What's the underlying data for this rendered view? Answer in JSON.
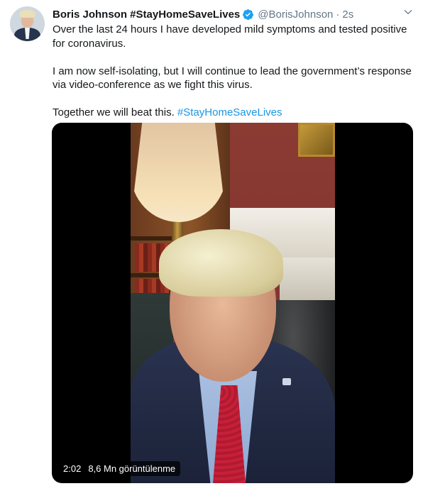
{
  "author": {
    "display_name": "Boris Johnson #StayHomeSaveLives",
    "handle": "@BorisJohnson",
    "separator": "·",
    "timestamp": "2s",
    "verified": true,
    "verified_icon": "verified-badge-icon"
  },
  "tweet": {
    "paragraph_1": "Over the last 24 hours I have developed mild symptoms and tested positive for coronavirus.",
    "paragraph_2": "I am now self-isolating, but I will continue to lead the government’s response via video-conference as we fight this virus.",
    "paragraph_3_text": "Together we will beat this. ",
    "paragraph_3_hashtag": "#StayHomeSaveLives"
  },
  "video": {
    "duration": "2:02",
    "views": "8,6 Mn görüntülenme"
  },
  "colors": {
    "link": "#1b95e0",
    "secondary_text": "#657786",
    "verified_badge": "#1da1f2"
  }
}
